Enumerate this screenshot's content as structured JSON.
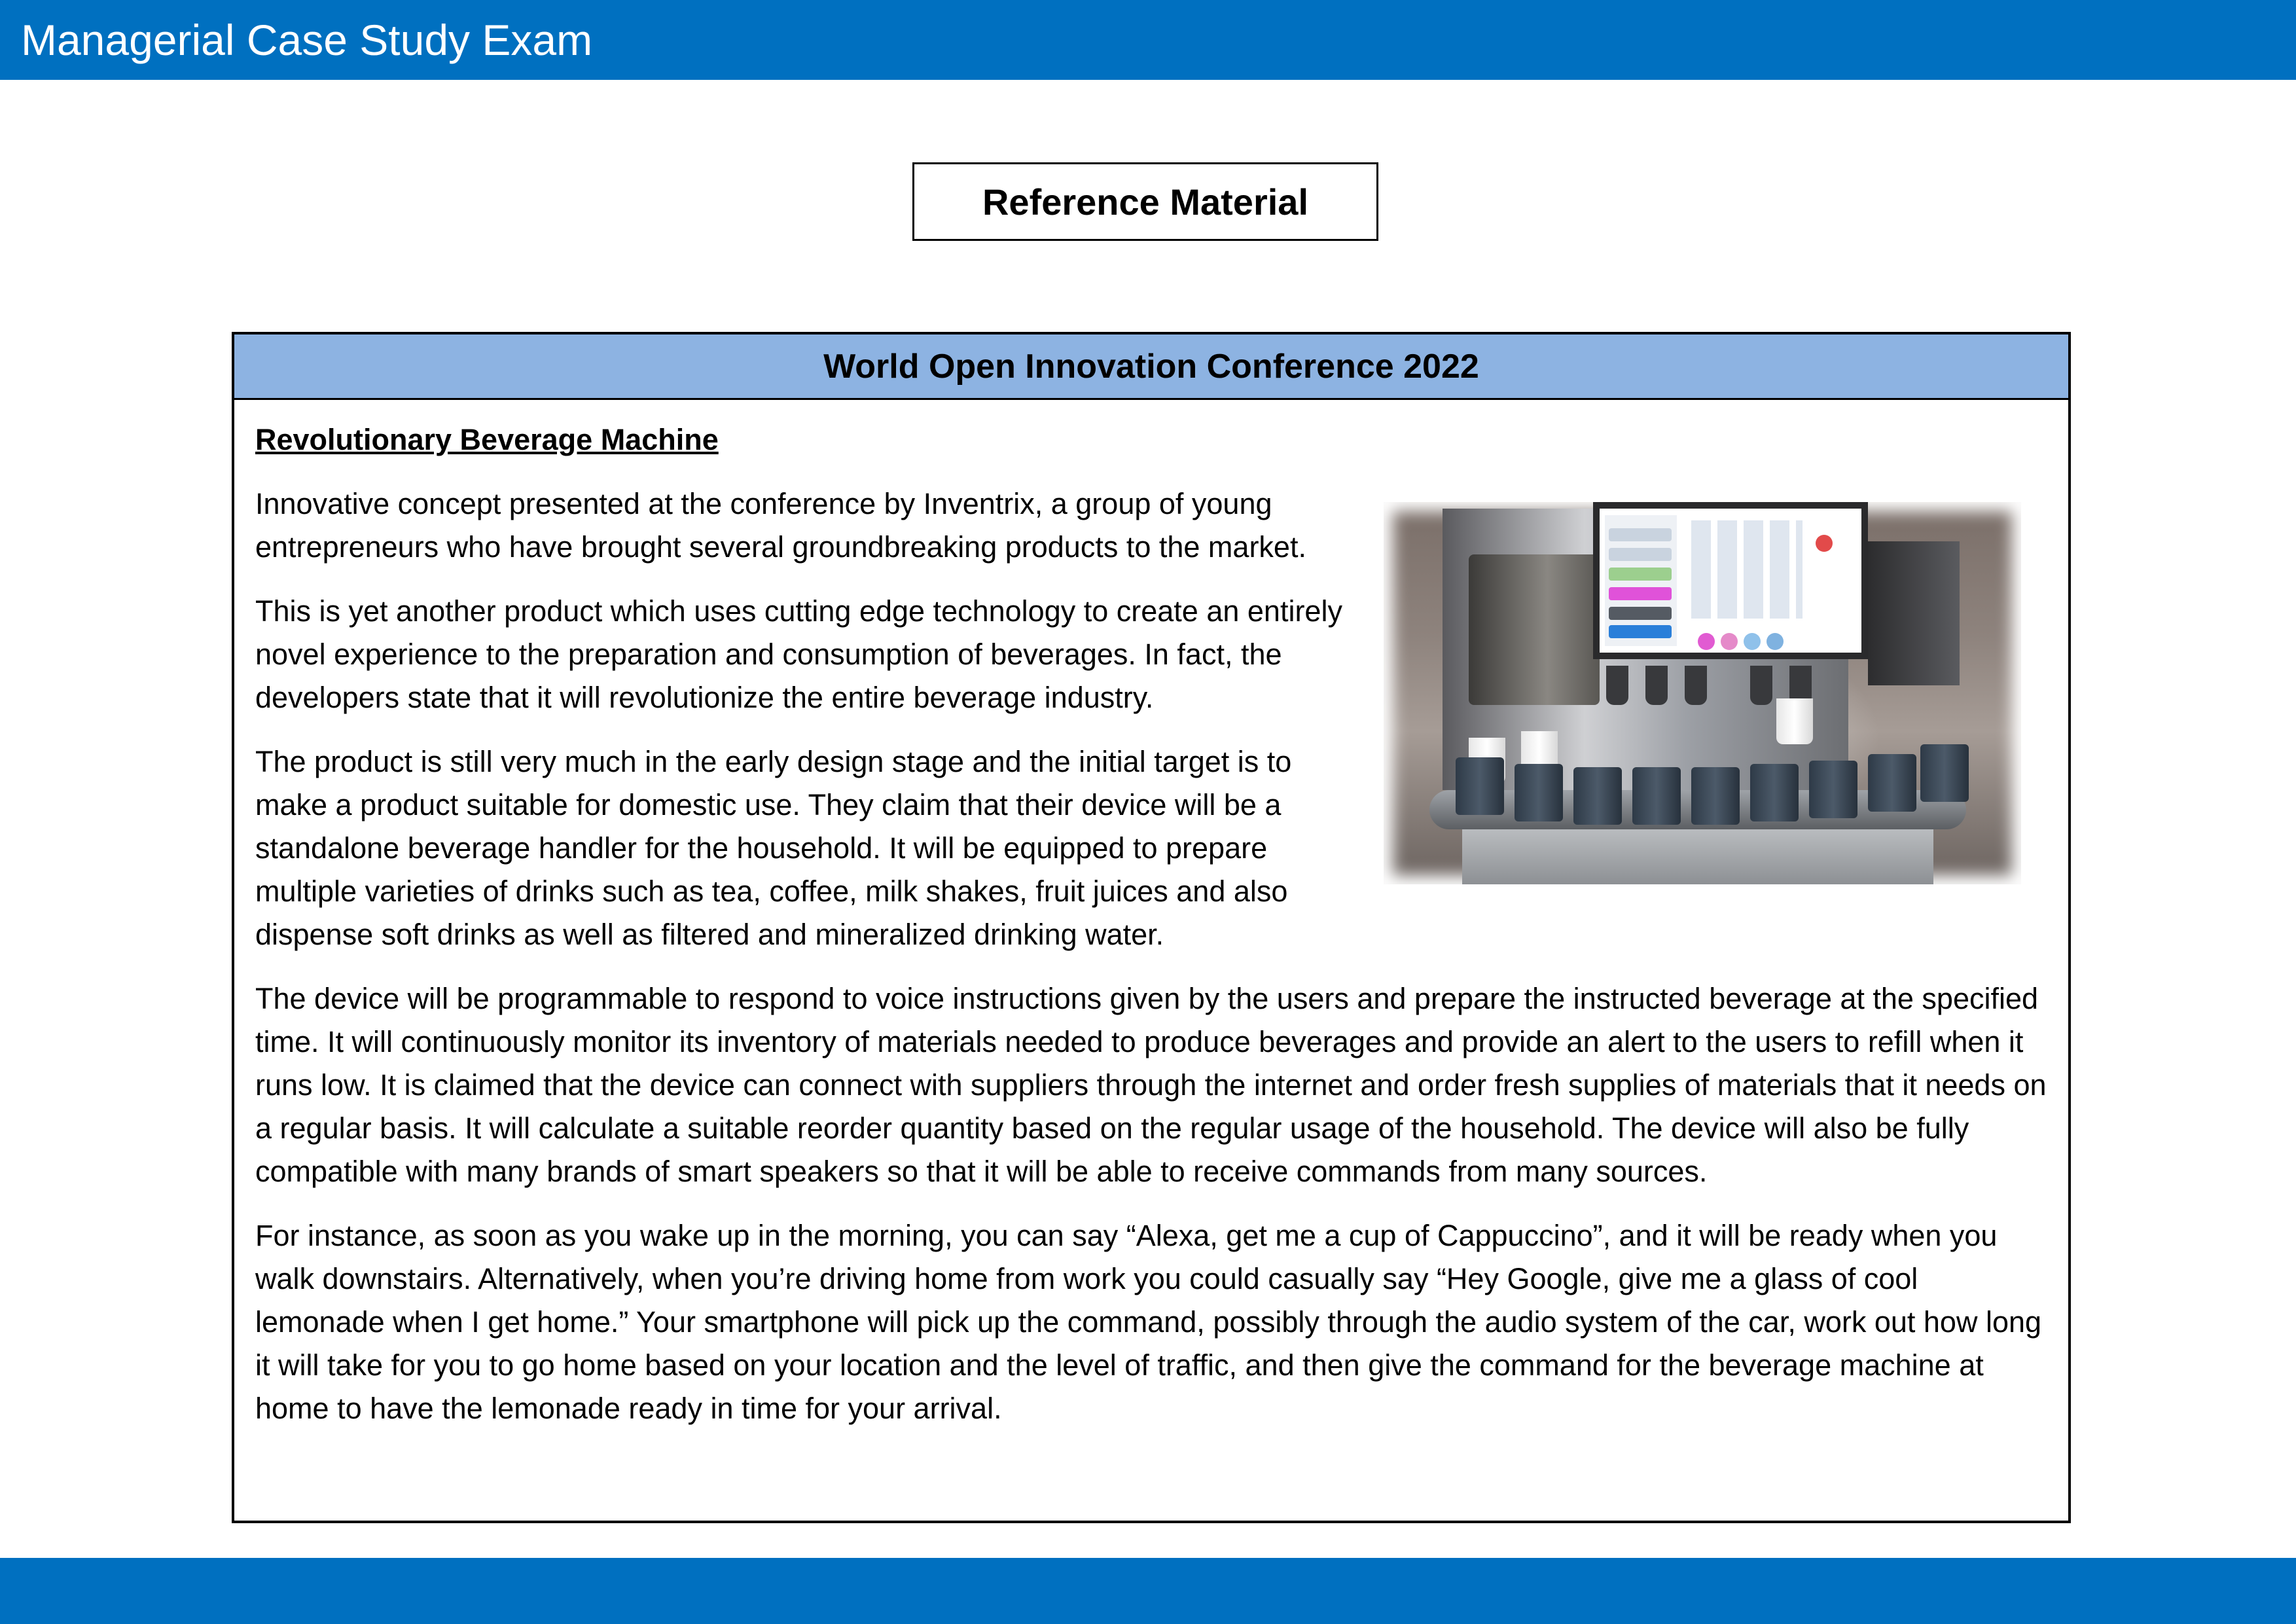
{
  "header": {
    "title": "Managerial Case Study Exam"
  },
  "reference_label": "Reference Material",
  "panel": {
    "title": "World Open Innovation Conference 2022",
    "section_title": "Revolutionary Beverage Machine",
    "paragraphs": [
      "Innovative concept presented at the conference by Inventrix, a group of young entrepreneurs who have brought several groundbreaking products to the market.",
      "This is yet another product which uses cutting edge technology to create an entirely novel experience to the preparation and consumption of beverages. In fact, the developers state that it will revolutionize the entire beverage industry.",
      "The product is still very much in the early design stage and the initial target is to make a product suitable for domestic use. They claim that their device will be a standalone beverage handler for the household. It will be equipped to prepare multiple varieties of drinks such as tea, coffee, milk shakes, fruit juices and also dispense soft drinks as well as filtered and mineralized drinking water.",
      "The device will be programmable to respond to voice instructions given by the users and prepare the instructed beverage at the specified time. It will continuously monitor its inventory of materials needed to produce beverages and provide an alert to the users to refill when it runs low. It is claimed that the device can connect with suppliers through the internet and order fresh supplies of materials that it needs on a regular basis. It will calculate a suitable reorder quantity based on the regular usage of the household. The device will also be fully compatible with many brands of smart speakers so that it will be able to receive commands from many sources.",
      "For instance, as soon as you wake up in the morning, you can say “Alexa, get me a cup of Cappuccino”, and it will be ready when you walk downstairs. Alternatively, when you’re driving home from work you could casually say “Hey Google, give me a glass of cool lemonade when I get home.” Your smartphone will pick up the command, possibly through the audio system of the car, work out how long it will take for you to go home based on your location and the level of traffic, and then give the command for the beverage machine at home to have the lemonade ready in time for your arrival."
    ]
  },
  "colors": {
    "brand_bar": "#0070c0",
    "panel_header": "#8db3e2"
  }
}
